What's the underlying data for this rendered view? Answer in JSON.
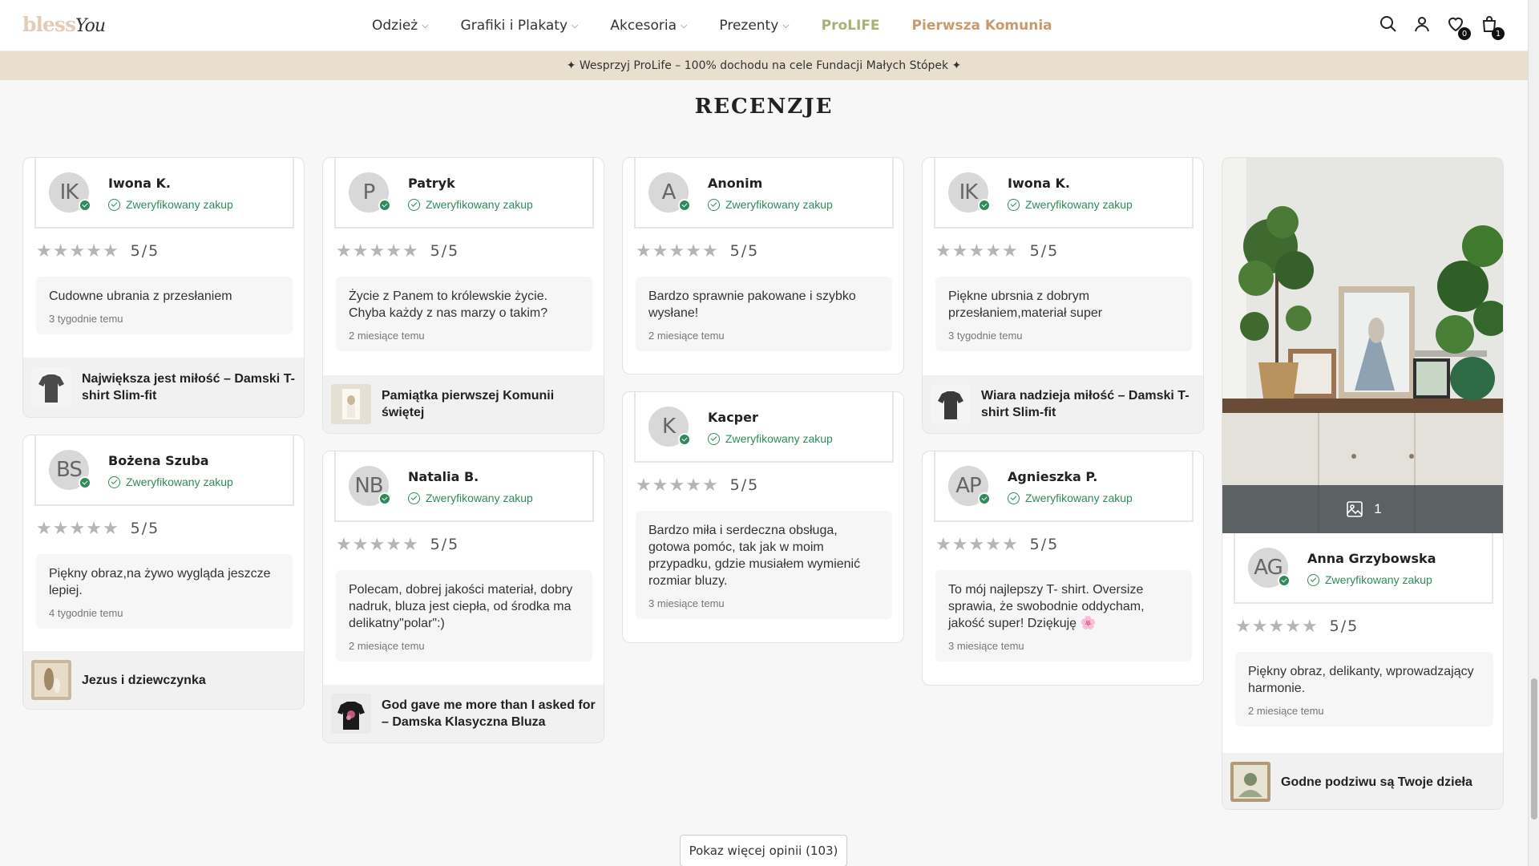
{
  "header": {
    "logo_part1": "bless",
    "logo_part2": "You",
    "nav": [
      {
        "label": "Odzież",
        "has_dropdown": true
      },
      {
        "label": "Grafiki i Plakaty",
        "has_dropdown": true
      },
      {
        "label": "Akcesoria",
        "has_dropdown": true
      },
      {
        "label": "Prezenty",
        "has_dropdown": true
      },
      {
        "label": "ProLIFE",
        "has_dropdown": false,
        "color": "#a9b075"
      },
      {
        "label": "Pierwsza Komunia",
        "has_dropdown": false,
        "color": "#c79b6d"
      }
    ],
    "icons": [
      "search-icon",
      "user-icon",
      "wishlist-icon",
      "cart-icon"
    ],
    "wishlist_count": "0",
    "cart_count": "1"
  },
  "promo_text": "✦ Wesprzyj ProLife – 100% dochodu na cele Fundacji Małych Stópek ✦",
  "section_title": "RECENZJE",
  "verified_label": "Zweryfikowany zakup",
  "reviews": [
    {
      "initials": "IK",
      "name": "Iwona K.",
      "rating": "5/5",
      "text": "Cudowne ubrania z przesłaniem",
      "date": "3 tygodnie temu",
      "product": "Największa jest miłość – Damski T-shirt Slim-fit"
    },
    {
      "initials": "BS",
      "name": "Bożena Szuba",
      "rating": "5/5",
      "text": "Piękny obraz,na żywo wygląda jeszcze lepiej.",
      "date": "4 tygodnie temu",
      "product": "Jezus i dziewczynka"
    },
    {
      "initials": "P",
      "name": "Patryk",
      "rating": "5/5",
      "text": "Życie z Panem to królewskie życie. Chyba każdy z nas marzy o takim?",
      "date": "2 miesiące temu",
      "product": "Pamiątka pierwszej Komunii świętej"
    },
    {
      "initials": "NB",
      "name": "Natalia B.",
      "rating": "5/5",
      "text": "Polecam, dobrej jakości materiał, dobry nadruk, bluza jest ciepła, od środka ma delikatny\"polar\":)",
      "date": "2 miesiące temu",
      "product": "God gave me more than I asked for – Damska Klasyczna Bluza"
    },
    {
      "initials": "A",
      "name": "Anonim",
      "rating": "5/5",
      "text": "Bardzo sprawnie pakowane i szybko wysłane!",
      "date": "2 miesiące temu"
    },
    {
      "initials": "K",
      "name": "Kacper",
      "rating": "5/5",
      "text": "Bardzo miła i serdeczna obsługa, gotowa pomóc, tak jak w moim przypadku, gdzie musiałem wymienić rozmiar bluzy.",
      "date": "3 miesiące temu"
    },
    {
      "initials": "IK",
      "name": "Iwona K.",
      "rating": "5/5",
      "text": "Piękne ubrsnia z dobrym przesłaniem,materiał super",
      "date": "3 tygodnie temu",
      "product": "Wiara nadzieja miłość – Damski T-shirt Slim-fit"
    },
    {
      "initials": "AP",
      "name": "Agnieszka P.",
      "rating": "5/5",
      "text": "To mój najlepszy T- shirt. Oversize sprawia, że swobodnie oddycham, jakość super! Dziękuję 🌸",
      "date": "3 miesiące temu"
    },
    {
      "initials": "AG",
      "name": "Anna Grzybowska",
      "rating": "5/5",
      "text": "Piękny obraz, delikanty, wprowadzający harmonie.",
      "date": "2 miesiące temu",
      "product": "Godne podziwu są Twoje dzieła",
      "photo_count": "1"
    }
  ],
  "more_button": "Pokaz więcej opinii (103)"
}
